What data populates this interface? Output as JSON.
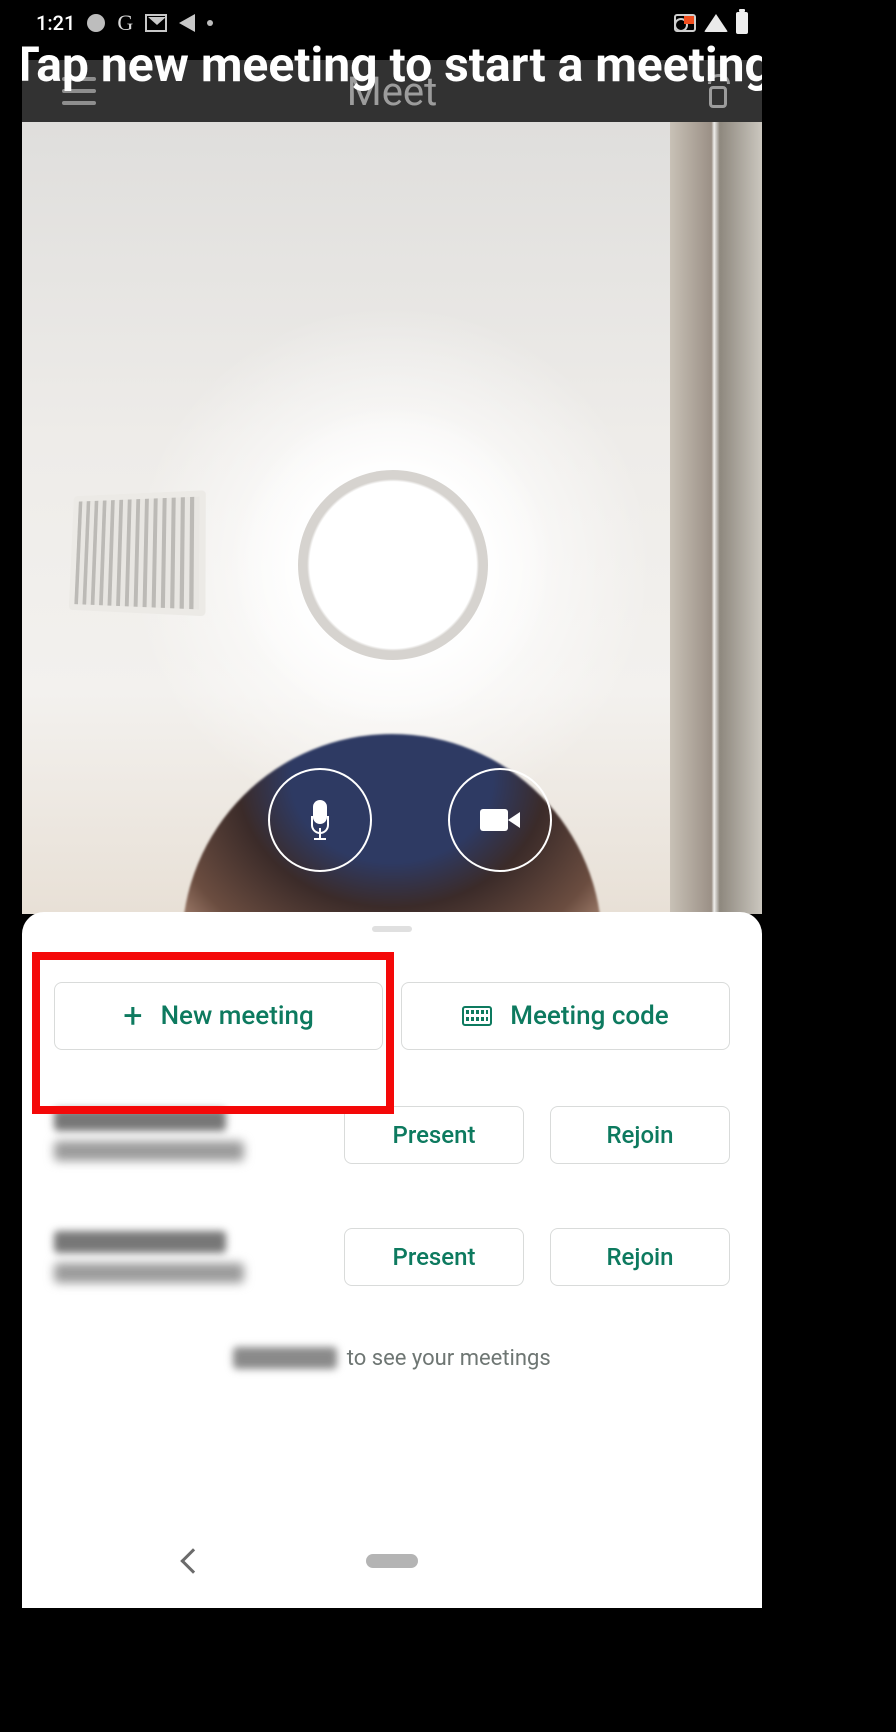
{
  "statusbar": {
    "time": "1:21"
  },
  "instruction": "Tap new meeting to start a meeting",
  "header": {
    "title": "Meet"
  },
  "actions": {
    "new_meeting": "New meeting",
    "meeting_code": "Meeting code"
  },
  "meetings": [
    {
      "present": "Present",
      "rejoin": "Rejoin"
    },
    {
      "present": "Present",
      "rejoin": "Rejoin"
    }
  ],
  "hint": {
    "suffix": " to see your meetings"
  },
  "colors": {
    "accent": "#0d7a5f",
    "highlight": "#f40808"
  }
}
